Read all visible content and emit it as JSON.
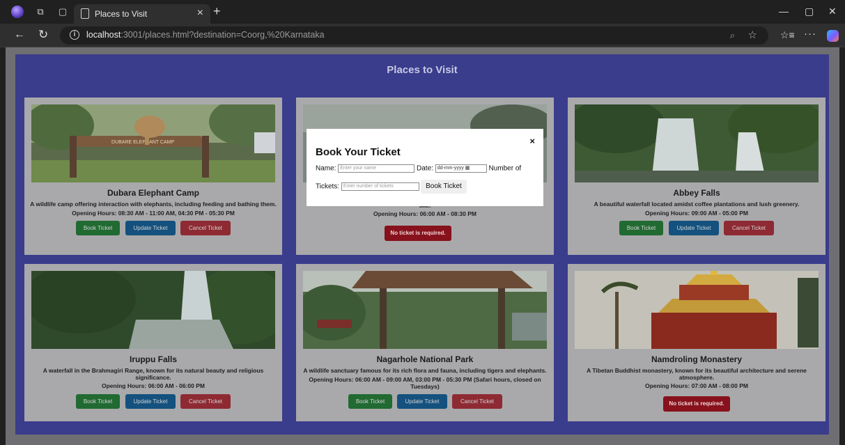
{
  "browser": {
    "tab_title": "Places to Visit",
    "url_host": "localhost",
    "url_rest": ":3001/places.html?destination=Coorg,%20Karnataka"
  },
  "page": {
    "title": "Places to Visit"
  },
  "buttons": {
    "book": "Book Ticket",
    "update": "Update Ticket",
    "cancel": "Cancel Ticket",
    "no_ticket": "No ticket is required."
  },
  "places": [
    {
      "name": "Dubara Elephant Camp",
      "description": "A wildlife camp offering interaction with elephants, including feeding and bathing them.",
      "hours": "Opening Hours: 08:30 AM - 11:00 AM, 04:30 PM - 05:30 PM",
      "sign_text": "DUBARE ELEPHANT CAMP"
    },
    {
      "description_tail": "site.",
      "hours": "Opening Hours: 06:00 AM - 08:30 PM"
    },
    {
      "name": "Abbey Falls",
      "description": "A beautiful waterfall located amidst coffee plantations and lush greenery.",
      "hours": "Opening Hours: 09:00 AM - 05:00 PM"
    },
    {
      "name": "Iruppu Falls",
      "description": "A waterfall in the Brahmagiri Range, known for its natural beauty and religious significance.",
      "hours": "Opening Hours: 06:00 AM - 06:00 PM"
    },
    {
      "name": "Nagarhole National Park",
      "description": "A wildlife sanctuary famous for its rich flora and fauna, including tigers and elephants.",
      "hours": "Opening Hours: 06:00 AM - 09:00 AM, 03:00 PM - 05:30 PM (Safari hours, closed on Tuesdays)"
    },
    {
      "name": "Namdroling Monastery",
      "description": "A Tibetan Buddhist monastery, known for its beautiful architecture and serene atmosphere.",
      "hours": "Opening Hours: 07:00 AM - 08:00 PM"
    }
  ],
  "modal": {
    "title": "Book Your Ticket",
    "close": "×",
    "name_label": "Name:",
    "name_placeholder": "Enter your name",
    "date_label": "Date:",
    "date_value": "dd-mm-yyyy",
    "tickets_label_1": "Number of",
    "tickets_label_2": "Tickets:",
    "tickets_placeholder": "Enter number of tickets",
    "submit": "Book Ticket"
  },
  "icons": {
    "back": "arrow-left-icon",
    "reload": "reload-icon",
    "info": "info-icon",
    "zoom": "zoom-icon",
    "favorite": "star-icon",
    "favorites": "favorites-icon",
    "more": "more-icon",
    "copilot": "copilot-icon"
  }
}
